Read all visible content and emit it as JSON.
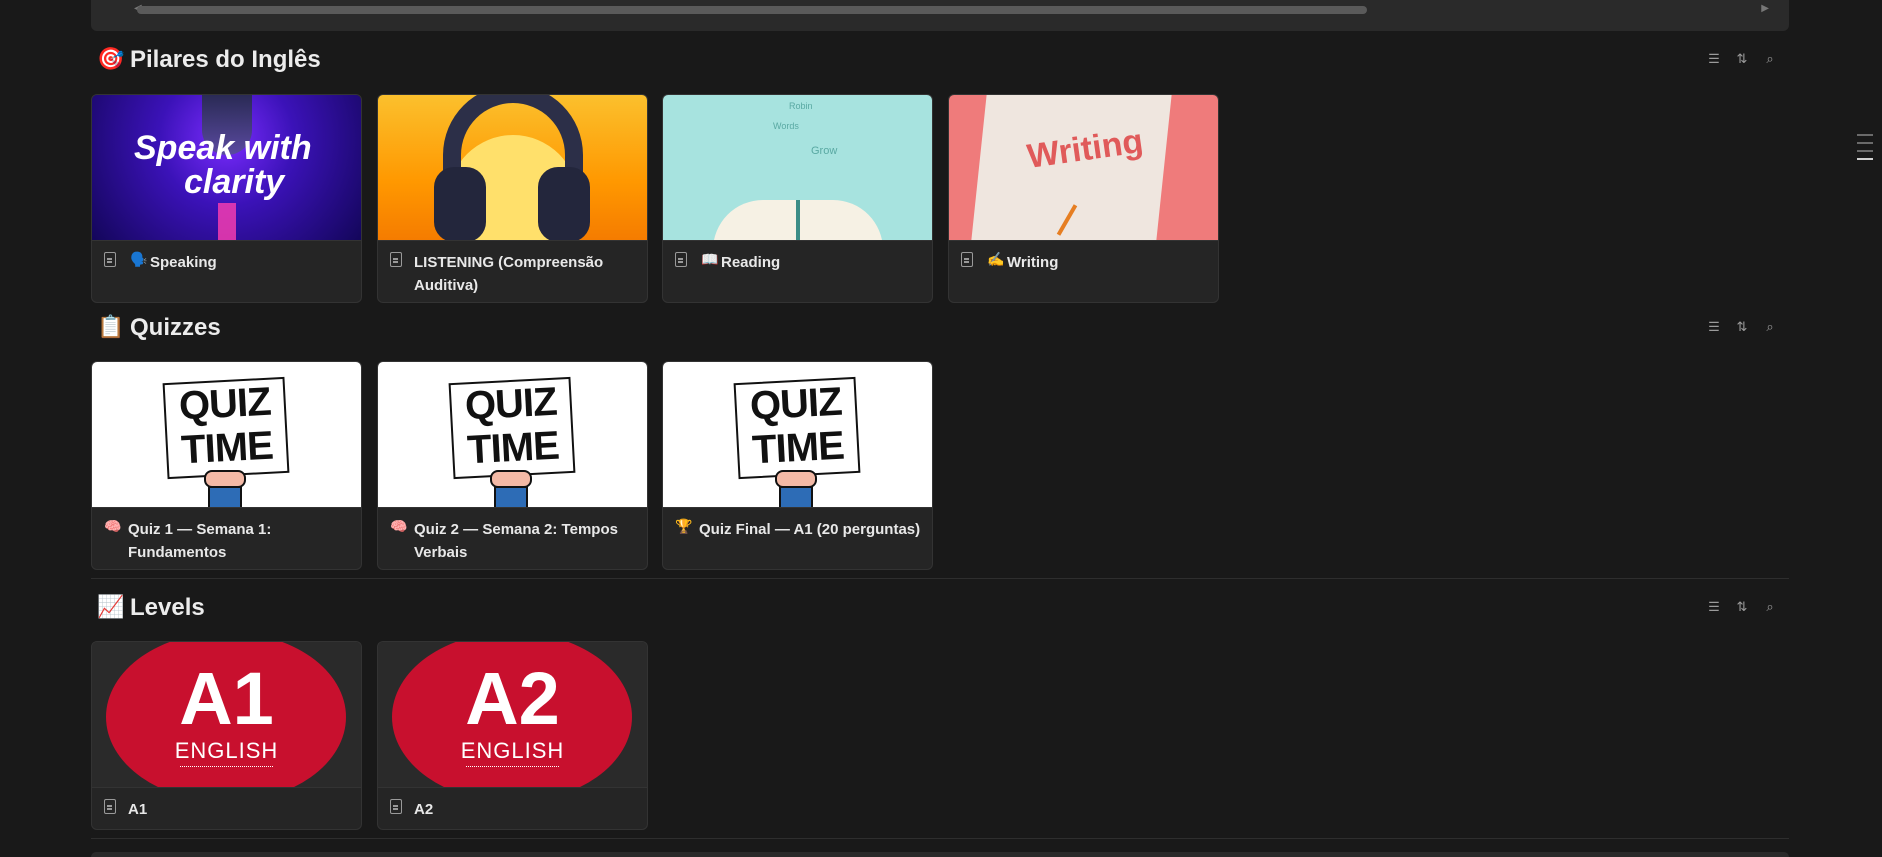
{
  "sections": {
    "pilares": {
      "emoji": "🎯",
      "title": "Pilares do Inglês",
      "cards": [
        {
          "emoji": "🗣️",
          "label": "Speaking",
          "thumb_text_1": "Speak with",
          "thumb_text_2": "clarity"
        },
        {
          "emoji": "",
          "label": "LISTENING (Compreensão Auditiva)"
        },
        {
          "emoji": "📖",
          "label": "Reading",
          "thumb_words": [
            "Robin",
            "Words",
            "Grow"
          ]
        },
        {
          "emoji": "✍️",
          "label": "Writing",
          "thumb_text": "Writing"
        }
      ]
    },
    "quizzes": {
      "emoji": "📋",
      "title": "Quizzes",
      "thumb_line_1": "QUIZ",
      "thumb_line_2": "TIME",
      "cards": [
        {
          "emoji": "🧠",
          "label": "Quiz 1 — Semana 1: Fundamentos"
        },
        {
          "emoji": "🧠",
          "label": "Quiz 2 — Semana 2: Tempos Verbais"
        },
        {
          "emoji": "🏆",
          "label": "Quiz Final — A1 (20 perguntas)"
        }
      ]
    },
    "levels": {
      "emoji": "📈",
      "title": "Levels",
      "thumb_sub": "ENGLISH",
      "cards": [
        {
          "level": "A1",
          "label": "A1"
        },
        {
          "level": "A2",
          "label": "A2"
        }
      ]
    }
  },
  "icons": {
    "filter": "filter-icon",
    "sort": "sort-icon",
    "search": "search-icon",
    "page": "page-icon"
  }
}
